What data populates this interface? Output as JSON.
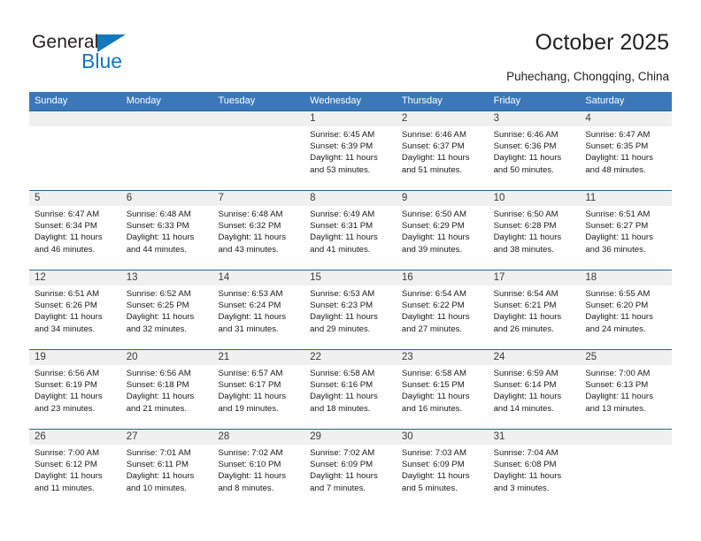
{
  "logo": {
    "text_top": "General",
    "text_bottom": "Blue",
    "triangle_color": "#1277bf"
  },
  "header": {
    "title": "October 2025",
    "subtitle": "Puhechang, Chongqing, China"
  },
  "theme": {
    "header_bg": "#3b78b9",
    "header_text": "#ffffff",
    "week_divider": "#2b6097",
    "daynum_bg": "#f0f0f0",
    "cell_bg": "#ffffff"
  },
  "weekdays": [
    "Sunday",
    "Monday",
    "Tuesday",
    "Wednesday",
    "Thursday",
    "Friday",
    "Saturday"
  ],
  "weeks": [
    [
      {
        "day": "",
        "sunrise": "",
        "sunset": "",
        "daylight1": "",
        "daylight2": ""
      },
      {
        "day": "",
        "sunrise": "",
        "sunset": "",
        "daylight1": "",
        "daylight2": ""
      },
      {
        "day": "",
        "sunrise": "",
        "sunset": "",
        "daylight1": "",
        "daylight2": ""
      },
      {
        "day": "1",
        "sunrise": "Sunrise: 6:45 AM",
        "sunset": "Sunset: 6:39 PM",
        "daylight1": "Daylight: 11 hours",
        "daylight2": "and 53 minutes."
      },
      {
        "day": "2",
        "sunrise": "Sunrise: 6:46 AM",
        "sunset": "Sunset: 6:37 PM",
        "daylight1": "Daylight: 11 hours",
        "daylight2": "and 51 minutes."
      },
      {
        "day": "3",
        "sunrise": "Sunrise: 6:46 AM",
        "sunset": "Sunset: 6:36 PM",
        "daylight1": "Daylight: 11 hours",
        "daylight2": "and 50 minutes."
      },
      {
        "day": "4",
        "sunrise": "Sunrise: 6:47 AM",
        "sunset": "Sunset: 6:35 PM",
        "daylight1": "Daylight: 11 hours",
        "daylight2": "and 48 minutes."
      }
    ],
    [
      {
        "day": "5",
        "sunrise": "Sunrise: 6:47 AM",
        "sunset": "Sunset: 6:34 PM",
        "daylight1": "Daylight: 11 hours",
        "daylight2": "and 46 minutes."
      },
      {
        "day": "6",
        "sunrise": "Sunrise: 6:48 AM",
        "sunset": "Sunset: 6:33 PM",
        "daylight1": "Daylight: 11 hours",
        "daylight2": "and 44 minutes."
      },
      {
        "day": "7",
        "sunrise": "Sunrise: 6:48 AM",
        "sunset": "Sunset: 6:32 PM",
        "daylight1": "Daylight: 11 hours",
        "daylight2": "and 43 minutes."
      },
      {
        "day": "8",
        "sunrise": "Sunrise: 6:49 AM",
        "sunset": "Sunset: 6:31 PM",
        "daylight1": "Daylight: 11 hours",
        "daylight2": "and 41 minutes."
      },
      {
        "day": "9",
        "sunrise": "Sunrise: 6:50 AM",
        "sunset": "Sunset: 6:29 PM",
        "daylight1": "Daylight: 11 hours",
        "daylight2": "and 39 minutes."
      },
      {
        "day": "10",
        "sunrise": "Sunrise: 6:50 AM",
        "sunset": "Sunset: 6:28 PM",
        "daylight1": "Daylight: 11 hours",
        "daylight2": "and 38 minutes."
      },
      {
        "day": "11",
        "sunrise": "Sunrise: 6:51 AM",
        "sunset": "Sunset: 6:27 PM",
        "daylight1": "Daylight: 11 hours",
        "daylight2": "and 36 minutes."
      }
    ],
    [
      {
        "day": "12",
        "sunrise": "Sunrise: 6:51 AM",
        "sunset": "Sunset: 6:26 PM",
        "daylight1": "Daylight: 11 hours",
        "daylight2": "and 34 minutes."
      },
      {
        "day": "13",
        "sunrise": "Sunrise: 6:52 AM",
        "sunset": "Sunset: 6:25 PM",
        "daylight1": "Daylight: 11 hours",
        "daylight2": "and 32 minutes."
      },
      {
        "day": "14",
        "sunrise": "Sunrise: 6:53 AM",
        "sunset": "Sunset: 6:24 PM",
        "daylight1": "Daylight: 11 hours",
        "daylight2": "and 31 minutes."
      },
      {
        "day": "15",
        "sunrise": "Sunrise: 6:53 AM",
        "sunset": "Sunset: 6:23 PM",
        "daylight1": "Daylight: 11 hours",
        "daylight2": "and 29 minutes."
      },
      {
        "day": "16",
        "sunrise": "Sunrise: 6:54 AM",
        "sunset": "Sunset: 6:22 PM",
        "daylight1": "Daylight: 11 hours",
        "daylight2": "and 27 minutes."
      },
      {
        "day": "17",
        "sunrise": "Sunrise: 6:54 AM",
        "sunset": "Sunset: 6:21 PM",
        "daylight1": "Daylight: 11 hours",
        "daylight2": "and 26 minutes."
      },
      {
        "day": "18",
        "sunrise": "Sunrise: 6:55 AM",
        "sunset": "Sunset: 6:20 PM",
        "daylight1": "Daylight: 11 hours",
        "daylight2": "and 24 minutes."
      }
    ],
    [
      {
        "day": "19",
        "sunrise": "Sunrise: 6:56 AM",
        "sunset": "Sunset: 6:19 PM",
        "daylight1": "Daylight: 11 hours",
        "daylight2": "and 23 minutes."
      },
      {
        "day": "20",
        "sunrise": "Sunrise: 6:56 AM",
        "sunset": "Sunset: 6:18 PM",
        "daylight1": "Daylight: 11 hours",
        "daylight2": "and 21 minutes."
      },
      {
        "day": "21",
        "sunrise": "Sunrise: 6:57 AM",
        "sunset": "Sunset: 6:17 PM",
        "daylight1": "Daylight: 11 hours",
        "daylight2": "and 19 minutes."
      },
      {
        "day": "22",
        "sunrise": "Sunrise: 6:58 AM",
        "sunset": "Sunset: 6:16 PM",
        "daylight1": "Daylight: 11 hours",
        "daylight2": "and 18 minutes."
      },
      {
        "day": "23",
        "sunrise": "Sunrise: 6:58 AM",
        "sunset": "Sunset: 6:15 PM",
        "daylight1": "Daylight: 11 hours",
        "daylight2": "and 16 minutes."
      },
      {
        "day": "24",
        "sunrise": "Sunrise: 6:59 AM",
        "sunset": "Sunset: 6:14 PM",
        "daylight1": "Daylight: 11 hours",
        "daylight2": "and 14 minutes."
      },
      {
        "day": "25",
        "sunrise": "Sunrise: 7:00 AM",
        "sunset": "Sunset: 6:13 PM",
        "daylight1": "Daylight: 11 hours",
        "daylight2": "and 13 minutes."
      }
    ],
    [
      {
        "day": "26",
        "sunrise": "Sunrise: 7:00 AM",
        "sunset": "Sunset: 6:12 PM",
        "daylight1": "Daylight: 11 hours",
        "daylight2": "and 11 minutes."
      },
      {
        "day": "27",
        "sunrise": "Sunrise: 7:01 AM",
        "sunset": "Sunset: 6:11 PM",
        "daylight1": "Daylight: 11 hours",
        "daylight2": "and 10 minutes."
      },
      {
        "day": "28",
        "sunrise": "Sunrise: 7:02 AM",
        "sunset": "Sunset: 6:10 PM",
        "daylight1": "Daylight: 11 hours",
        "daylight2": "and 8 minutes."
      },
      {
        "day": "29",
        "sunrise": "Sunrise: 7:02 AM",
        "sunset": "Sunset: 6:09 PM",
        "daylight1": "Daylight: 11 hours",
        "daylight2": "and 7 minutes."
      },
      {
        "day": "30",
        "sunrise": "Sunrise: 7:03 AM",
        "sunset": "Sunset: 6:09 PM",
        "daylight1": "Daylight: 11 hours",
        "daylight2": "and 5 minutes."
      },
      {
        "day": "31",
        "sunrise": "Sunrise: 7:04 AM",
        "sunset": "Sunset: 6:08 PM",
        "daylight1": "Daylight: 11 hours",
        "daylight2": "and 3 minutes."
      },
      {
        "day": "",
        "sunrise": "",
        "sunset": "",
        "daylight1": "",
        "daylight2": ""
      }
    ]
  ]
}
